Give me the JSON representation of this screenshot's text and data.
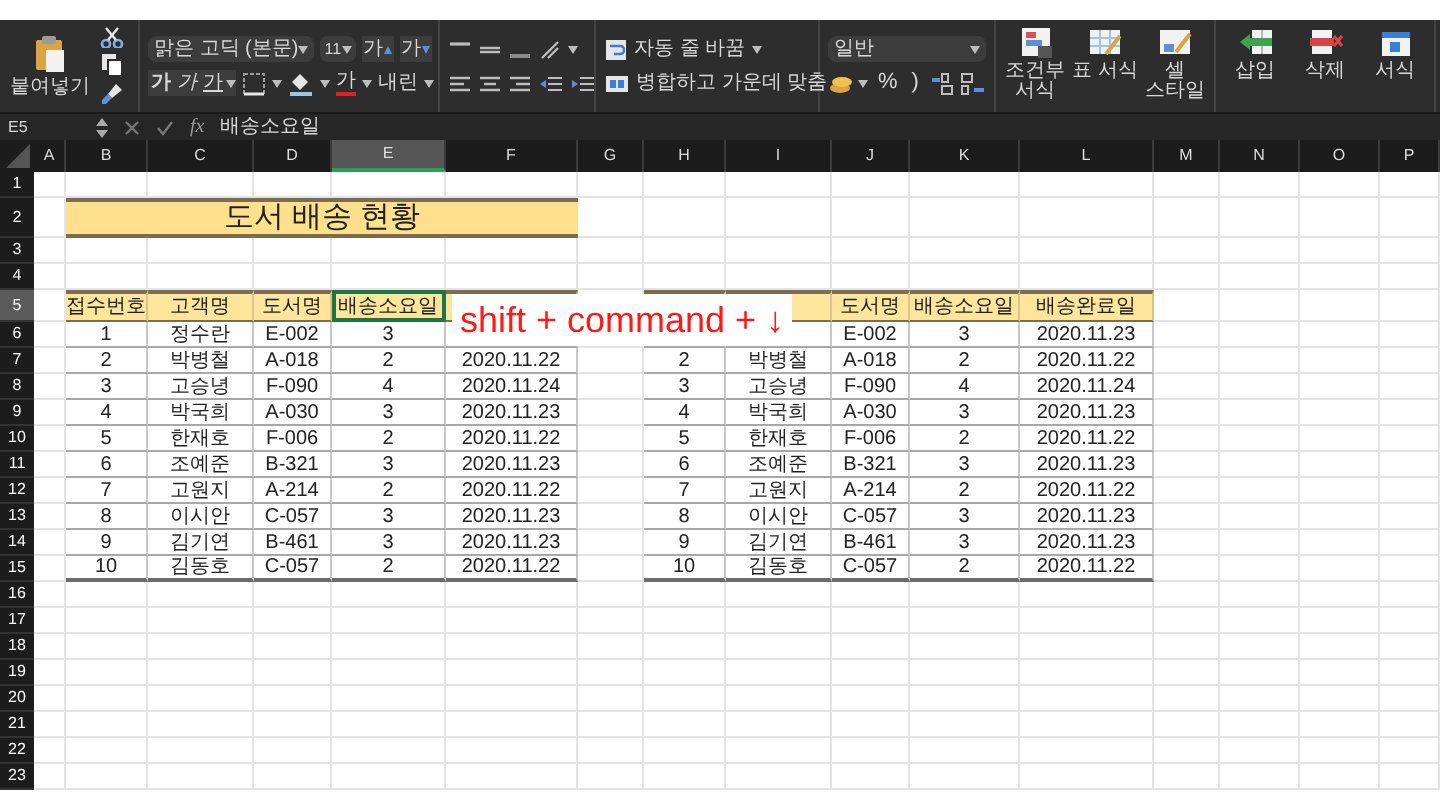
{
  "ribbon": {
    "paste": "붙여넣기",
    "font_name": "맑은 고딕 (본문)",
    "font_size": "11",
    "font_buttons": [
      {
        "kind": "grow",
        "label": "가"
      },
      {
        "kind": "shrink",
        "label": "가"
      }
    ],
    "style_buttons": [
      {
        "kind": "bold",
        "label": "가"
      },
      {
        "kind": "italic",
        "label": "가"
      },
      {
        "kind": "underline",
        "label": "가"
      }
    ],
    "font_color": "가",
    "phonetic": "내린",
    "wrap_text": "자동 줄 바꿈",
    "merge_center": "병합하고 가운데 맞춤",
    "number_format": "일반",
    "number_buttons": [
      "%",
      ")"
    ],
    "style_commands": [
      {
        "kind": "conditional",
        "label": "조건부 서식"
      },
      {
        "kind": "table",
        "label": "표 서식"
      },
      {
        "kind": "cell_style",
        "label": "셀 스타일"
      }
    ],
    "cell_commands": [
      {
        "kind": "insert",
        "label": "삽입"
      },
      {
        "kind": "delete",
        "label": "삭제"
      },
      {
        "kind": "format",
        "label": "서식"
      }
    ]
  },
  "formula_bar": {
    "name_box": "E5",
    "function_label": "fx",
    "formula": "배송소요일"
  },
  "sheet": {
    "columns": [
      {
        "label": "A",
        "selected": false
      },
      {
        "label": "B",
        "selected": false
      },
      {
        "label": "C",
        "selected": false
      },
      {
        "label": "D",
        "selected": false
      },
      {
        "label": "E",
        "selected": true
      },
      {
        "label": "F",
        "selected": false
      },
      {
        "label": "G",
        "selected": false
      },
      {
        "label": "H",
        "selected": false
      },
      {
        "label": "I",
        "selected": false
      },
      {
        "label": "J",
        "selected": false
      },
      {
        "label": "K",
        "selected": false
      },
      {
        "label": "L",
        "selected": false
      },
      {
        "label": "M",
        "selected": false
      },
      {
        "label": "N",
        "selected": false
      },
      {
        "label": "O",
        "selected": false
      },
      {
        "label": "P",
        "selected": false
      }
    ],
    "rows": [
      {
        "label": "1",
        "selected": false
      },
      {
        "label": "2",
        "selected": false
      },
      {
        "label": "3",
        "selected": false
      },
      {
        "label": "4",
        "selected": false
      },
      {
        "label": "5",
        "selected": true
      },
      {
        "label": "6",
        "selected": false
      },
      {
        "label": "7",
        "selected": false
      },
      {
        "label": "8",
        "selected": false
      },
      {
        "label": "9",
        "selected": false
      },
      {
        "label": "10",
        "selected": false
      },
      {
        "label": "11",
        "selected": false
      },
      {
        "label": "12",
        "selected": false
      },
      {
        "label": "13",
        "selected": false
      },
      {
        "label": "14",
        "selected": false
      },
      {
        "label": "15",
        "selected": false
      },
      {
        "label": "16",
        "selected": false
      },
      {
        "label": "17",
        "selected": false
      },
      {
        "label": "18",
        "selected": false
      },
      {
        "label": "19",
        "selected": false
      },
      {
        "label": "20",
        "selected": false
      },
      {
        "label": "21",
        "selected": false
      },
      {
        "label": "22",
        "selected": false
      },
      {
        "label": "23",
        "selected": false
      }
    ],
    "title": "도서 배송 현황",
    "tables": [
      {
        "headers": [
          {
            "text": "접수번호",
            "selected": false
          },
          {
            "text": "고객명",
            "selected": false
          },
          {
            "text": "도서명",
            "selected": false
          },
          {
            "text": "배송소요일",
            "selected": true
          },
          {
            "kind": "covered"
          }
        ],
        "rows": [
          [
            "1",
            "정수란",
            "E-002",
            "3",
            null
          ],
          [
            "2",
            "박병철",
            "A-018",
            "2",
            "2020.11.22"
          ],
          [
            "3",
            "고승녕",
            "F-090",
            "4",
            "2020.11.24"
          ],
          [
            "4",
            "박국희",
            "A-030",
            "3",
            "2020.11.23"
          ],
          [
            "5",
            "한재호",
            "F-006",
            "2",
            "2020.11.22"
          ],
          [
            "6",
            "조예준",
            "B-321",
            "3",
            "2020.11.23"
          ],
          [
            "7",
            "고원지",
            "A-214",
            "2",
            "2020.11.22"
          ],
          [
            "8",
            "이시안",
            "C-057",
            "3",
            "2020.11.23"
          ],
          [
            "9",
            "김기연",
            "B-461",
            "3",
            "2020.11.23"
          ],
          [
            "10",
            "김동호",
            "C-057",
            "2",
            "2020.11.22"
          ]
        ]
      },
      {
        "headers": [
          {
            "kind": "covered"
          },
          {
            "kind": "covered"
          },
          {
            "text": "도서명",
            "selected": false
          },
          {
            "text": "배송소요일",
            "selected": false
          },
          {
            "text": "배송완료일",
            "selected": false
          }
        ],
        "rows": [
          [
            null,
            null,
            "E-002",
            "3",
            "2020.11.23"
          ],
          [
            "2",
            "박병철",
            "A-018",
            "2",
            "2020.11.22"
          ],
          [
            "3",
            "고승녕",
            "F-090",
            "4",
            "2020.11.24"
          ],
          [
            "4",
            "박국희",
            "A-030",
            "3",
            "2020.11.23"
          ],
          [
            "5",
            "한재호",
            "F-006",
            "2",
            "2020.11.22"
          ],
          [
            "6",
            "조예준",
            "B-321",
            "3",
            "2020.11.23"
          ],
          [
            "7",
            "고원지",
            "A-214",
            "2",
            "2020.11.22"
          ],
          [
            "8",
            "이시안",
            "C-057",
            "3",
            "2020.11.23"
          ],
          [
            "9",
            "김기연",
            "B-461",
            "3",
            "2020.11.23"
          ],
          [
            "10",
            "김동호",
            "C-057",
            "2",
            "2020.11.22"
          ]
        ]
      }
    ]
  },
  "caption": "shift + command + ↓"
}
